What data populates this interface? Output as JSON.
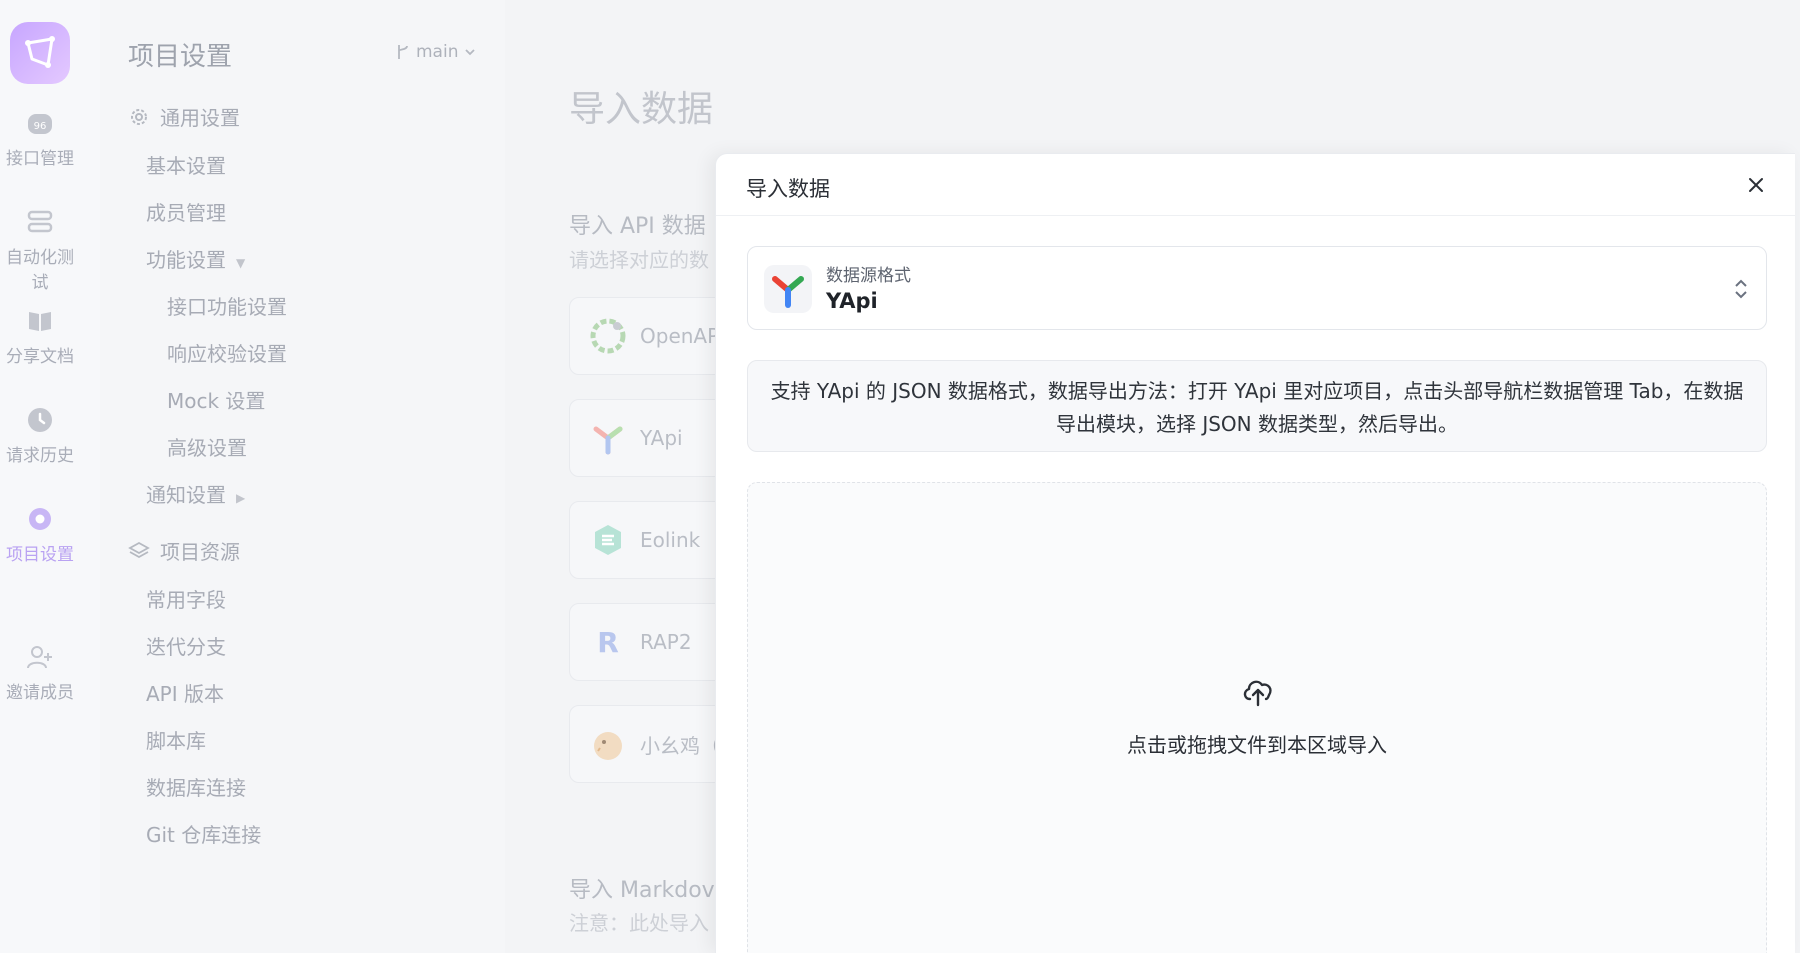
{
  "rail": {
    "items": [
      {
        "label": "接口管理",
        "icon": "api-icon"
      },
      {
        "label": "自动化测试",
        "icon": "automation-icon"
      },
      {
        "label": "分享文档",
        "icon": "book-icon"
      },
      {
        "label": "请求历史",
        "icon": "clock-icon"
      },
      {
        "label": "项目设置",
        "icon": "settings-icon"
      },
      {
        "label": "邀请成员",
        "icon": "user-plus-icon"
      }
    ],
    "accent": "#b9a2f2"
  },
  "settings": {
    "title": "项目设置",
    "branch": "main",
    "groups": {
      "general": "通用设置",
      "resources": "项目资源"
    },
    "items": {
      "basic": "基本设置",
      "members": "成员管理",
      "features": "功能设置",
      "api_features": "接口功能设置",
      "response_validation": "响应校验设置",
      "mock": "Mock 设置",
      "advanced": "高级设置",
      "notifications": "通知设置",
      "common_fields": "常用字段",
      "iteration_branches": "迭代分支",
      "api_versions": "API 版本",
      "script_library": "脚本库",
      "db_connection": "数据库连接",
      "git_connection": "Git 仓库连接"
    }
  },
  "main": {
    "title": "导入数据",
    "api_section_title": "导入 API 数据",
    "api_section_sub": "请选择对应的数",
    "sources": [
      "OpenAP",
      "YApi",
      "Eolink",
      "RAP2",
      "小幺鸡（"
    ],
    "md_section_title": "导入 Markdov",
    "md_section_sub": "注意：此处导入"
  },
  "modal": {
    "title": "导入数据",
    "select_label": "数据源格式",
    "select_value": "YApi",
    "description": "支持 YApi 的 JSON 数据格式，数据导出方法：打开 YApi 里对应项目，点击头部导航栏数据管理 Tab，在数据导出模块，选择 JSON 数据类型，然后导出。",
    "dropzone_text": "点击或拖拽文件到本区域导入"
  }
}
